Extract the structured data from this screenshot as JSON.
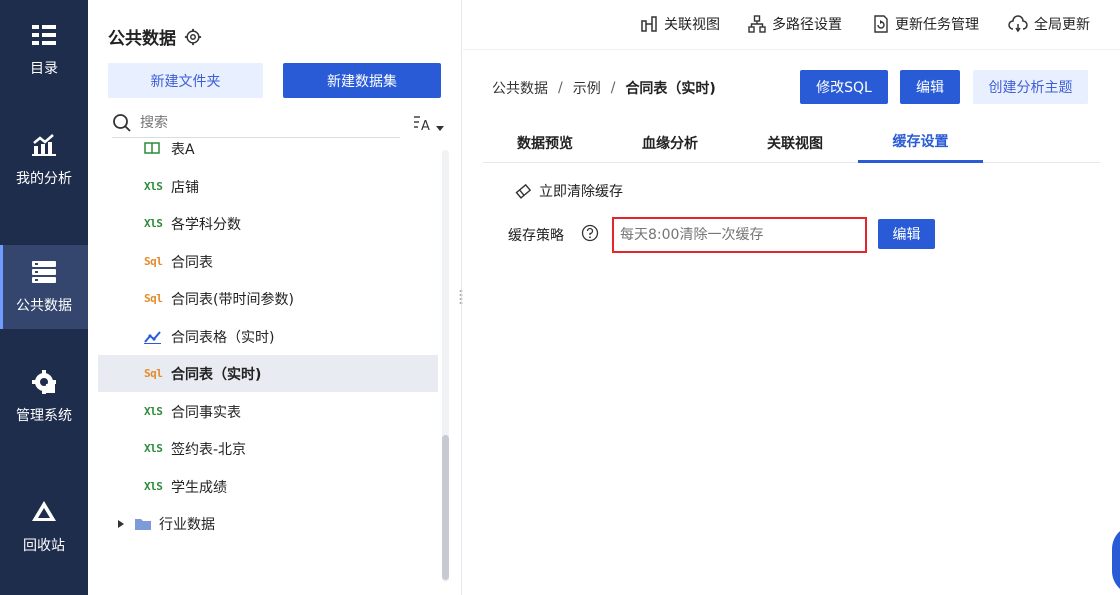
{
  "nav": {
    "items": [
      {
        "label": "目录",
        "icon": "catalog-icon"
      },
      {
        "label": "我的分析",
        "icon": "my-analysis-icon"
      },
      {
        "label": "公共数据",
        "icon": "public-data-icon"
      },
      {
        "label": "管理系统",
        "icon": "admin-system-icon"
      },
      {
        "label": "回收站",
        "icon": "recycle-bin-icon"
      }
    ],
    "active_index": 2,
    "background": "#1f2d4d"
  },
  "tree": {
    "title": "公共数据",
    "new_folder_label": "新建文件夹",
    "new_dataset_label": "新建数据集",
    "search_placeholder": "搜索",
    "items": [
      {
        "label": "表A",
        "type": "table"
      },
      {
        "label": "店铺",
        "type": "xls"
      },
      {
        "label": "各学科分数",
        "type": "xls"
      },
      {
        "label": "合同表",
        "type": "sql"
      },
      {
        "label": "合同表(带时间参数)",
        "type": "sql"
      },
      {
        "label": "合同表格（实时)",
        "type": "chart"
      },
      {
        "label": "合同表（实时)",
        "type": "sql",
        "active": true
      },
      {
        "label": "合同事实表",
        "type": "xls"
      },
      {
        "label": "签约表-北京",
        "type": "xls"
      },
      {
        "label": "学生成绩",
        "type": "xls"
      }
    ],
    "folder": {
      "label": "行业数据"
    },
    "xls_text": "XlS",
    "sql_text": "Sql"
  },
  "topbar": {
    "actions": [
      {
        "label": "关联视图",
        "icon": "relation-view-icon"
      },
      {
        "label": "多路径设置",
        "icon": "multi-path-icon"
      },
      {
        "label": "更新任务管理",
        "icon": "update-task-icon"
      },
      {
        "label": "全局更新",
        "icon": "global-update-icon"
      }
    ]
  },
  "breadcrumb": {
    "items": [
      "公共数据",
      "示例",
      "合同表（实时)"
    ],
    "separator": "/"
  },
  "header_buttons": {
    "modify_sql": "修改SQL",
    "edit": "编辑",
    "create_topic": "创建分析主题"
  },
  "tabs": {
    "items": [
      "数据预览",
      "血缘分析",
      "关联视图",
      "缓存设置"
    ],
    "active_index": 3
  },
  "cache": {
    "clear_now_label": "立即清除缓存",
    "strategy_label": "缓存策略",
    "strategy_placeholder": "每天8:00清除一次缓存",
    "edit_label": "编辑"
  },
  "colors": {
    "primary": "#2a5bd7",
    "highlight_border": "#e2262c",
    "xls": "#2c8a3c",
    "sql": "#e38b2a"
  }
}
